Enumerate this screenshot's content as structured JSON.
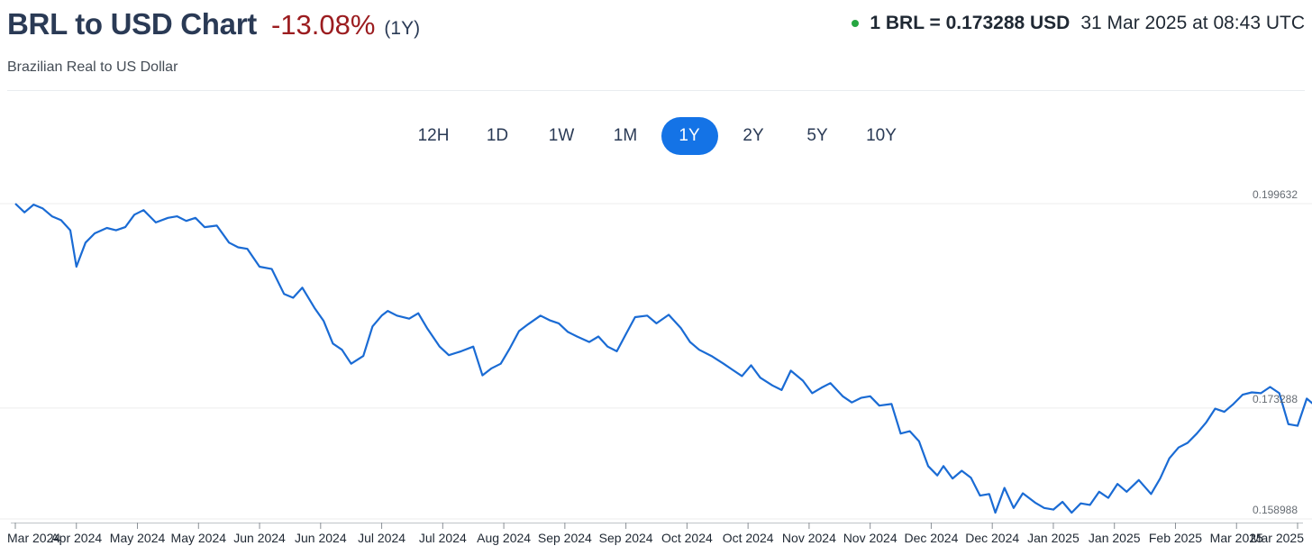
{
  "header": {
    "title": "BRL to USD Chart",
    "change": "-13.08%",
    "period": "(1Y)",
    "subtitle": "Brazilian Real to US Dollar",
    "rate": "1 BRL = 0.173288 USD",
    "timestamp": "31 Mar 2025 at 08:43 UTC"
  },
  "colors": {
    "line": "#1a6bd4",
    "negative": "#9b1c1f",
    "live_dot": "#26a641",
    "active_tab": "#1473e6"
  },
  "tabs": [
    {
      "label": "12H",
      "active": false
    },
    {
      "label": "1D",
      "active": false
    },
    {
      "label": "1W",
      "active": false
    },
    {
      "label": "1M",
      "active": false
    },
    {
      "label": "1Y",
      "active": true
    },
    {
      "label": "2Y",
      "active": false
    },
    {
      "label": "5Y",
      "active": false
    },
    {
      "label": "10Y",
      "active": false
    }
  ],
  "chart_data": {
    "type": "line",
    "title": "BRL to USD Chart",
    "ylim": [
      0.158988,
      0.199632
    ],
    "y_tick_labels": [
      "0.199632",
      "0.173288",
      "0.158988"
    ],
    "x_tick_labels": [
      "Mar 2024",
      "Apr 2024",
      "May 2024",
      "May 2024",
      "Jun 2024",
      "Jun 2024",
      "Jul 2024",
      "Jul 2024",
      "Aug 2024",
      "Sep 2024",
      "Sep 2024",
      "Oct 2024",
      "Oct 2024",
      "Nov 2024",
      "Nov 2024",
      "Dec 2024",
      "Dec 2024",
      "Jan 2025",
      "Jan 2025",
      "Feb 2025",
      "Mar 2025",
      "Mar 2025"
    ],
    "grid": true,
    "series": [
      {
        "x_index": [
          0,
          0.15,
          0.3,
          0.45,
          0.6,
          0.75,
          0.9,
          1.0,
          1.15,
          1.3,
          1.5,
          1.65,
          1.8,
          1.95,
          2.1,
          2.3,
          2.5,
          2.65,
          2.8,
          2.95,
          3.1,
          3.3,
          3.5,
          3.65,
          3.8,
          4.0,
          4.2,
          4.4,
          4.55,
          4.7,
          4.9,
          5.05,
          5.2,
          5.35,
          5.5,
          5.7,
          5.85,
          6.0,
          6.1,
          6.25,
          6.45,
          6.6,
          6.75,
          6.95,
          7.1,
          7.3,
          7.5,
          7.65,
          7.8,
          7.95,
          8.1,
          8.25,
          8.4,
          8.6,
          8.75,
          8.9,
          9.05,
          9.2,
          9.4,
          9.55,
          9.7,
          9.85,
          10.0,
          10.15,
          10.35,
          10.5,
          10.7,
          10.9,
          11.05,
          11.2,
          11.4,
          11.6,
          11.75,
          11.9,
          12.05,
          12.2,
          12.4,
          12.55,
          12.7,
          12.9,
          13.05,
          13.2,
          13.35,
          13.55,
          13.7,
          13.85,
          14.0,
          14.15,
          14.35,
          14.5,
          14.65,
          14.8,
          14.95,
          15.1,
          15.2,
          15.35,
          15.5,
          15.65,
          15.8,
          15.95,
          16.05,
          16.2,
          16.35,
          16.5,
          16.7,
          16.85,
          17.0,
          17.15,
          17.3,
          17.45,
          17.6,
          17.75,
          17.9,
          18.05,
          18.2,
          18.4,
          18.6,
          18.75,
          18.9,
          19.05,
          19.2,
          19.35,
          19.5,
          19.65,
          19.8,
          19.95,
          20.1,
          20.25,
          20.4,
          20.55,
          20.7,
          20.85,
          21.0,
          21.15,
          21.3,
          21.5,
          21.65,
          21.8,
          21.9,
          22.0
        ],
        "values": [
          0.199632,
          0.1985,
          0.1995,
          0.199,
          0.198,
          0.1975,
          0.1962,
          0.1915,
          0.1946,
          0.1958,
          0.1965,
          0.1962,
          0.1966,
          0.1982,
          0.1988,
          0.1972,
          0.1978,
          0.198,
          0.1974,
          0.1978,
          0.1966,
          0.1968,
          0.1946,
          0.194,
          0.1938,
          0.1915,
          0.1912,
          0.188,
          0.1875,
          0.1888,
          0.1862,
          0.1845,
          0.1816,
          0.1808,
          0.179,
          0.18,
          0.1838,
          0.1852,
          0.1858,
          0.1852,
          0.1848,
          0.1855,
          0.1835,
          0.1812,
          0.1801,
          0.1806,
          0.1812,
          0.1775,
          0.1784,
          0.179,
          0.181,
          0.1832,
          0.1841,
          0.1852,
          0.1846,
          0.1842,
          0.1831,
          0.1825,
          0.1818,
          0.1825,
          0.1812,
          0.1806,
          0.1828,
          0.185,
          0.1852,
          0.1842,
          0.1853,
          0.1836,
          0.1818,
          0.1808,
          0.18,
          0.179,
          0.1782,
          0.1774,
          0.1788,
          0.1772,
          0.1762,
          0.1756,
          0.1781,
          0.1768,
          0.1752,
          0.1759,
          0.1765,
          0.1748,
          0.174,
          0.1746,
          0.1748,
          0.1736,
          0.1738,
          0.17,
          0.1703,
          0.169,
          0.1658,
          0.1646,
          0.1658,
          0.1642,
          0.1652,
          0.1643,
          0.162,
          0.1622,
          0.1598,
          0.163,
          0.1604,
          0.1623,
          0.1611,
          0.1604,
          0.1602,
          0.1612,
          0.1598,
          0.161,
          0.1608,
          0.1625,
          0.1617,
          0.1635,
          0.1625,
          0.164,
          0.1622,
          0.1642,
          0.1668,
          0.1682,
          0.1688,
          0.17,
          0.1714,
          0.1732,
          0.1728,
          0.1738,
          0.175,
          0.1753,
          0.1752,
          0.176,
          0.1752,
          0.1712,
          0.171,
          0.1745,
          0.1735,
          0.176,
          0.1772,
          0.1755,
          0.1748,
          0.174
        ]
      }
    ]
  }
}
